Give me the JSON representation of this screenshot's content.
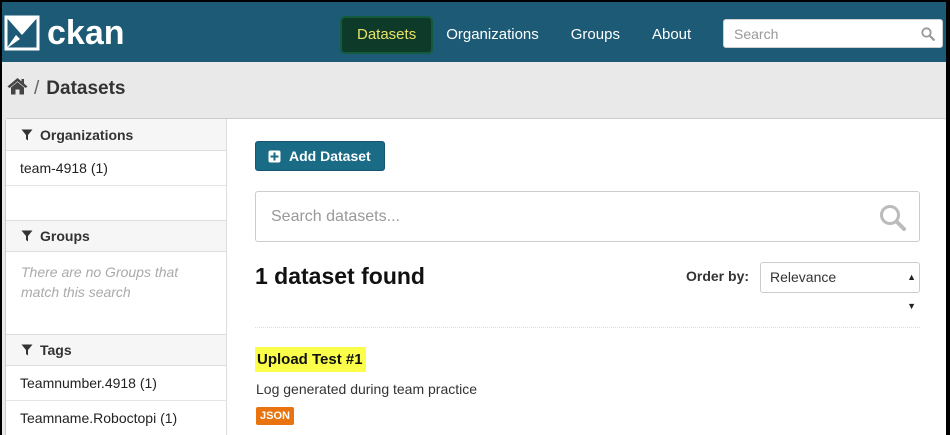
{
  "header": {
    "logo_text": "ckan",
    "nav": [
      {
        "label": "Datasets",
        "active": true
      },
      {
        "label": "Organizations",
        "active": false
      },
      {
        "label": "Groups",
        "active": false
      },
      {
        "label": "About",
        "active": false
      }
    ],
    "search_placeholder": "Search"
  },
  "breadcrumb": {
    "separator": "/",
    "current": "Datasets"
  },
  "sidebar": {
    "organizations": {
      "title": "Organizations",
      "items": [
        "team-4918 (1)"
      ]
    },
    "groups": {
      "title": "Groups",
      "empty_text": "There are no Groups that match this search"
    },
    "tags": {
      "title": "Tags",
      "items": [
        "Teamnumber.4918 (1)",
        "Teamname.Roboctopi (1)"
      ]
    }
  },
  "main": {
    "add_button": "Add Dataset",
    "search_placeholder": "Search datasets...",
    "results_count": "1 dataset found",
    "order_label": "Order by:",
    "order_value": "Relevance",
    "datasets": [
      {
        "title": "Upload Test #1",
        "description": "Log generated during team practice",
        "formats": [
          "JSON"
        ]
      }
    ]
  },
  "colors": {
    "masthead": "#1c5a75",
    "active_nav_text": "#e8e266",
    "highlight": "#fbff49",
    "format_badge": "#e9730e",
    "primary_button": "#1a6b86"
  }
}
